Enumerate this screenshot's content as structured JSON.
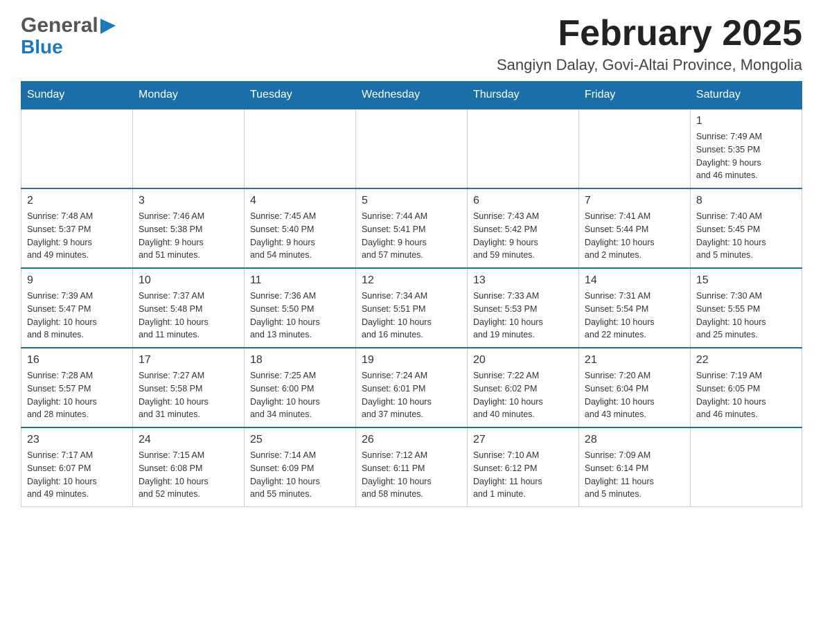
{
  "header": {
    "logo_general": "General",
    "logo_blue": "Blue",
    "month_title": "February 2025",
    "location": "Sangiyn Dalay, Govi-Altai Province, Mongolia"
  },
  "weekdays": [
    "Sunday",
    "Monday",
    "Tuesday",
    "Wednesday",
    "Thursday",
    "Friday",
    "Saturday"
  ],
  "weeks": [
    [
      {
        "day": "",
        "info": ""
      },
      {
        "day": "",
        "info": ""
      },
      {
        "day": "",
        "info": ""
      },
      {
        "day": "",
        "info": ""
      },
      {
        "day": "",
        "info": ""
      },
      {
        "day": "",
        "info": ""
      },
      {
        "day": "1",
        "info": "Sunrise: 7:49 AM\nSunset: 5:35 PM\nDaylight: 9 hours\nand 46 minutes."
      }
    ],
    [
      {
        "day": "2",
        "info": "Sunrise: 7:48 AM\nSunset: 5:37 PM\nDaylight: 9 hours\nand 49 minutes."
      },
      {
        "day": "3",
        "info": "Sunrise: 7:46 AM\nSunset: 5:38 PM\nDaylight: 9 hours\nand 51 minutes."
      },
      {
        "day": "4",
        "info": "Sunrise: 7:45 AM\nSunset: 5:40 PM\nDaylight: 9 hours\nand 54 minutes."
      },
      {
        "day": "5",
        "info": "Sunrise: 7:44 AM\nSunset: 5:41 PM\nDaylight: 9 hours\nand 57 minutes."
      },
      {
        "day": "6",
        "info": "Sunrise: 7:43 AM\nSunset: 5:42 PM\nDaylight: 9 hours\nand 59 minutes."
      },
      {
        "day": "7",
        "info": "Sunrise: 7:41 AM\nSunset: 5:44 PM\nDaylight: 10 hours\nand 2 minutes."
      },
      {
        "day": "8",
        "info": "Sunrise: 7:40 AM\nSunset: 5:45 PM\nDaylight: 10 hours\nand 5 minutes."
      }
    ],
    [
      {
        "day": "9",
        "info": "Sunrise: 7:39 AM\nSunset: 5:47 PM\nDaylight: 10 hours\nand 8 minutes."
      },
      {
        "day": "10",
        "info": "Sunrise: 7:37 AM\nSunset: 5:48 PM\nDaylight: 10 hours\nand 11 minutes."
      },
      {
        "day": "11",
        "info": "Sunrise: 7:36 AM\nSunset: 5:50 PM\nDaylight: 10 hours\nand 13 minutes."
      },
      {
        "day": "12",
        "info": "Sunrise: 7:34 AM\nSunset: 5:51 PM\nDaylight: 10 hours\nand 16 minutes."
      },
      {
        "day": "13",
        "info": "Sunrise: 7:33 AM\nSunset: 5:53 PM\nDaylight: 10 hours\nand 19 minutes."
      },
      {
        "day": "14",
        "info": "Sunrise: 7:31 AM\nSunset: 5:54 PM\nDaylight: 10 hours\nand 22 minutes."
      },
      {
        "day": "15",
        "info": "Sunrise: 7:30 AM\nSunset: 5:55 PM\nDaylight: 10 hours\nand 25 minutes."
      }
    ],
    [
      {
        "day": "16",
        "info": "Sunrise: 7:28 AM\nSunset: 5:57 PM\nDaylight: 10 hours\nand 28 minutes."
      },
      {
        "day": "17",
        "info": "Sunrise: 7:27 AM\nSunset: 5:58 PM\nDaylight: 10 hours\nand 31 minutes."
      },
      {
        "day": "18",
        "info": "Sunrise: 7:25 AM\nSunset: 6:00 PM\nDaylight: 10 hours\nand 34 minutes."
      },
      {
        "day": "19",
        "info": "Sunrise: 7:24 AM\nSunset: 6:01 PM\nDaylight: 10 hours\nand 37 minutes."
      },
      {
        "day": "20",
        "info": "Sunrise: 7:22 AM\nSunset: 6:02 PM\nDaylight: 10 hours\nand 40 minutes."
      },
      {
        "day": "21",
        "info": "Sunrise: 7:20 AM\nSunset: 6:04 PM\nDaylight: 10 hours\nand 43 minutes."
      },
      {
        "day": "22",
        "info": "Sunrise: 7:19 AM\nSunset: 6:05 PM\nDaylight: 10 hours\nand 46 minutes."
      }
    ],
    [
      {
        "day": "23",
        "info": "Sunrise: 7:17 AM\nSunset: 6:07 PM\nDaylight: 10 hours\nand 49 minutes."
      },
      {
        "day": "24",
        "info": "Sunrise: 7:15 AM\nSunset: 6:08 PM\nDaylight: 10 hours\nand 52 minutes."
      },
      {
        "day": "25",
        "info": "Sunrise: 7:14 AM\nSunset: 6:09 PM\nDaylight: 10 hours\nand 55 minutes."
      },
      {
        "day": "26",
        "info": "Sunrise: 7:12 AM\nSunset: 6:11 PM\nDaylight: 10 hours\nand 58 minutes."
      },
      {
        "day": "27",
        "info": "Sunrise: 7:10 AM\nSunset: 6:12 PM\nDaylight: 11 hours\nand 1 minute."
      },
      {
        "day": "28",
        "info": "Sunrise: 7:09 AM\nSunset: 6:14 PM\nDaylight: 11 hours\nand 5 minutes."
      },
      {
        "day": "",
        "info": ""
      }
    ]
  ]
}
